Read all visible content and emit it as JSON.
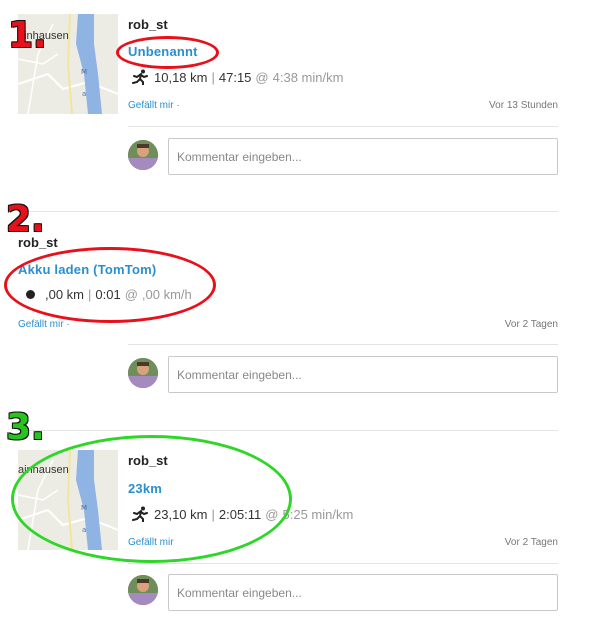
{
  "posts": [
    {
      "number": "1.",
      "user": "rob_st",
      "map_label": "Hainhausen",
      "map_label_visible": "ainhausen",
      "title": "Unbenannt",
      "distance": "10,18 km",
      "separator": "|",
      "duration": "47:15",
      "at": "@",
      "pace": "4:38 min/km",
      "like": "Gefällt mir ·",
      "time": "Vor 13 Stunden",
      "comment_placeholder": "Kommentar eingeben...",
      "activity_icon": "running-icon",
      "annotation_color": "#e8101a"
    },
    {
      "number": "2.",
      "user": "rob_st",
      "title": "Akku laden (TomTom)",
      "distance": ",00 km",
      "separator": "|",
      "duration": "0:01",
      "at": "@",
      "pace": ",00 km/h",
      "like": "Gefällt mir ·",
      "time": "Vor 2 Tagen",
      "comment_placeholder": "Kommentar eingeben...",
      "activity_icon": "dot-icon",
      "annotation_color": "#e8101a"
    },
    {
      "number": "3.",
      "user": "rob_st",
      "map_label_visible": "ainhausen",
      "title": "23km",
      "distance": "23,10 km",
      "separator": "|",
      "duration": "2:05:11",
      "at": "@",
      "pace": "5:25 min/km",
      "like": "Gefällt mir",
      "time": "Vor 2 Tagen",
      "comment_placeholder": "Kommentar eingeben...",
      "activity_icon": "running-icon",
      "annotation_color": "#2fd629"
    }
  ]
}
